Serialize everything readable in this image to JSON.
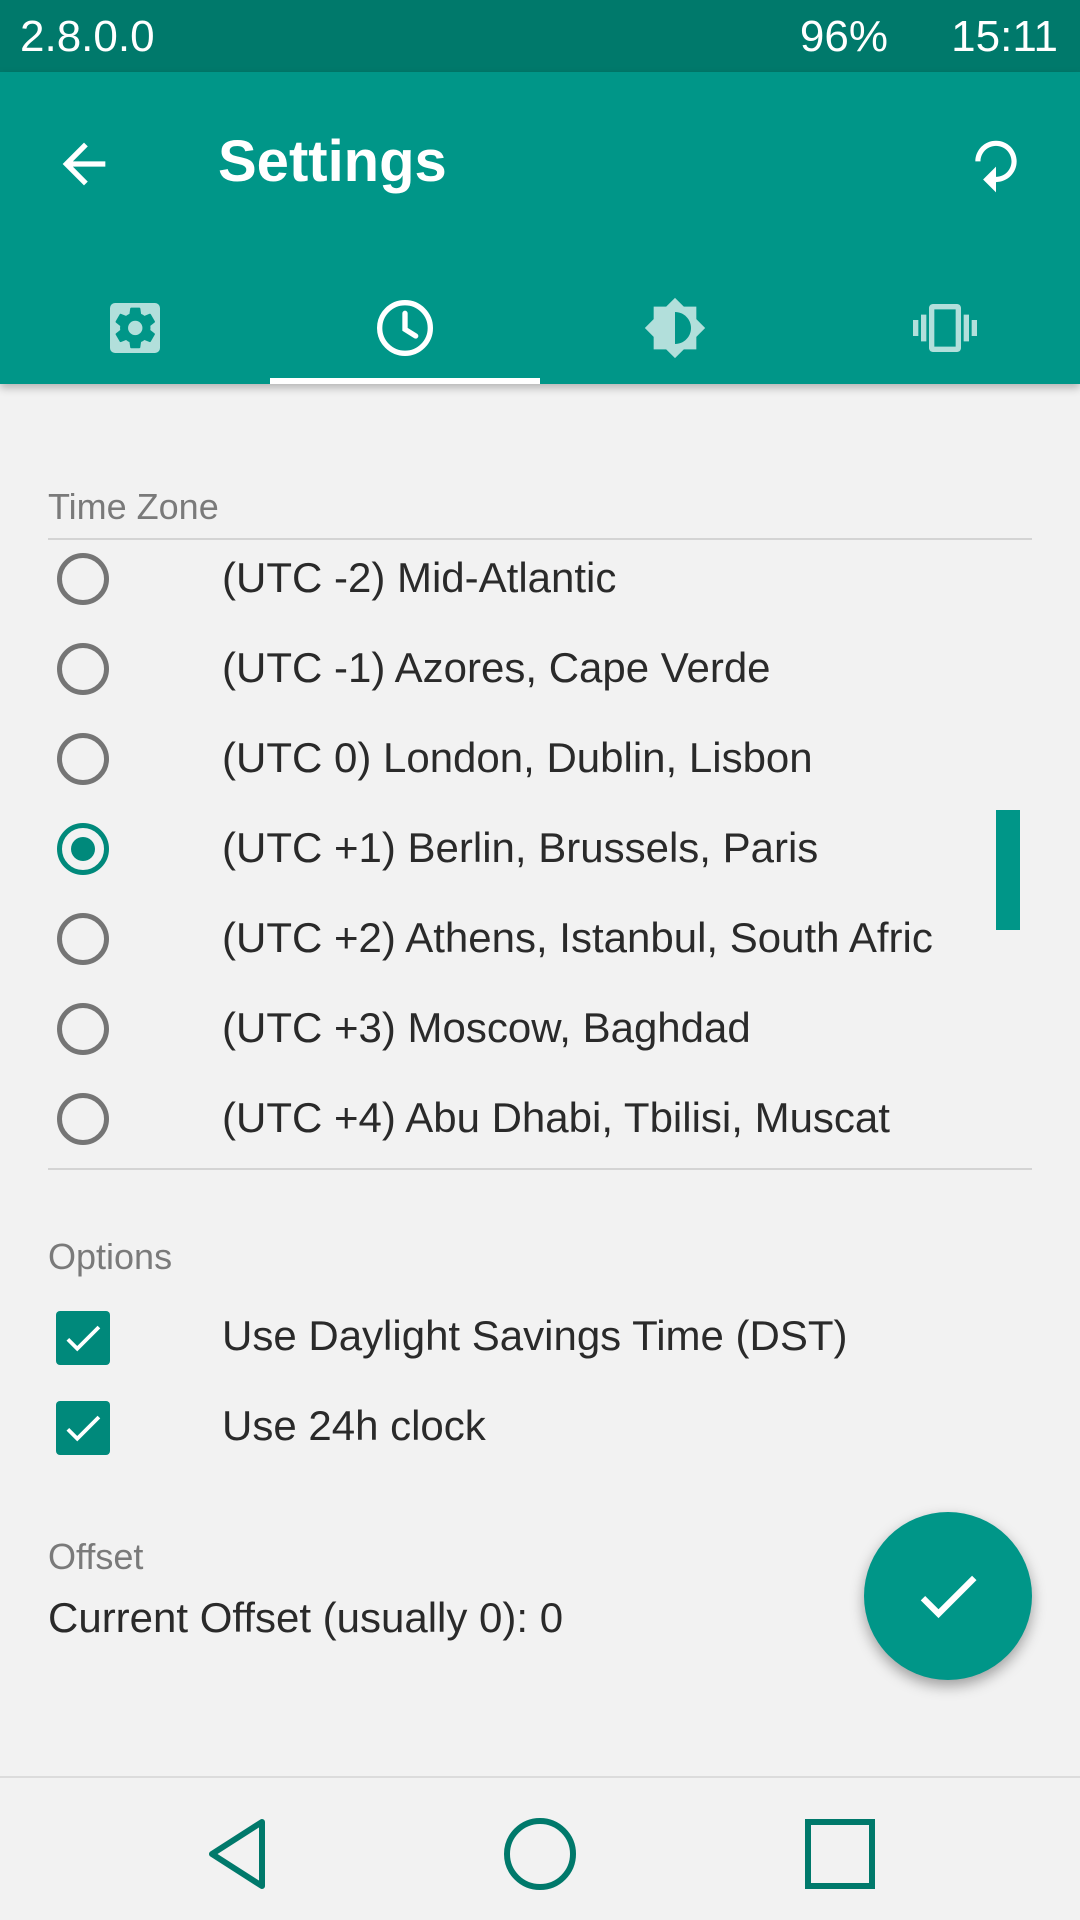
{
  "status_bar": {
    "version": "2.8.0.0",
    "battery": "96%",
    "time": "15:11"
  },
  "app_bar": {
    "title": "Settings",
    "back_icon": "arrow-back-icon",
    "reset_icon": "refresh-icon"
  },
  "tabs": [
    {
      "icon": "gear-icon",
      "active": false
    },
    {
      "icon": "clock-icon",
      "active": true
    },
    {
      "icon": "brightness-icon",
      "active": false
    },
    {
      "icon": "vibration-icon",
      "active": false
    }
  ],
  "time_zone": {
    "label": "Time Zone",
    "options": [
      {
        "label": "(UTC -2) Mid-Atlantic",
        "selected": false
      },
      {
        "label": "(UTC -1) Azores, Cape Verde",
        "selected": false
      },
      {
        "label": "(UTC  0) London, Dublin, Lisbon",
        "selected": false
      },
      {
        "label": "(UTC +1) Berlin, Brussels, Paris",
        "selected": true
      },
      {
        "label": "(UTC +2) Athens, Istanbul, South Afric",
        "selected": false
      },
      {
        "label": "(UTC +3) Moscow, Baghdad",
        "selected": false
      },
      {
        "label": "(UTC +4) Abu Dhabi, Tbilisi, Muscat",
        "selected": false
      }
    ]
  },
  "options": {
    "label": "Options",
    "items": [
      {
        "label": "Use Daylight Savings Time (DST)",
        "checked": true
      },
      {
        "label": "Use 24h clock",
        "checked": true
      }
    ]
  },
  "offset": {
    "label": "Offset",
    "text": "Current Offset (usually 0): 0"
  },
  "fab": {
    "icon": "check-icon"
  },
  "nav_bar": {
    "back_icon": "nav-back-icon",
    "home_icon": "nav-home-icon",
    "recents_icon": "nav-recents-icon"
  },
  "colors": {
    "primary": "#009688",
    "primary_dark": "#00796b",
    "accent": "#00897b"
  }
}
